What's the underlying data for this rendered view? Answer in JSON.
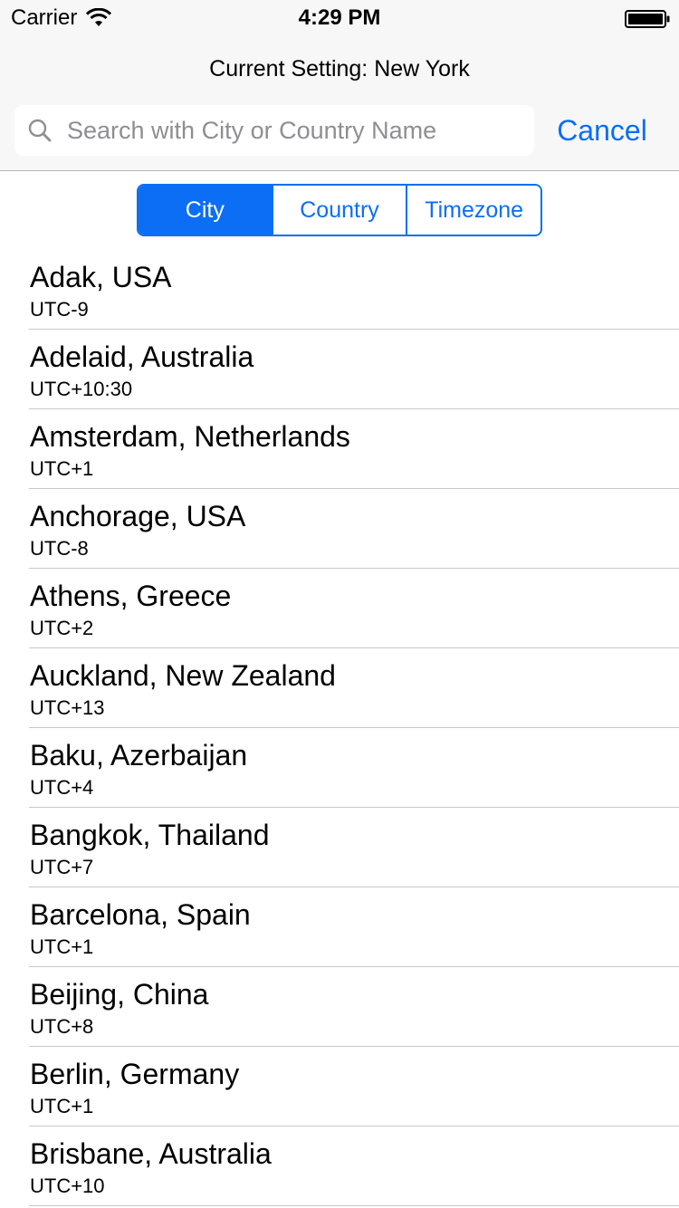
{
  "status_bar": {
    "carrier": "Carrier",
    "time": "4:29 PM"
  },
  "header": {
    "current_setting": "Current Setting: New York"
  },
  "search": {
    "placeholder": "Search with City or Country Name",
    "value": "",
    "cancel_label": "Cancel"
  },
  "segments": [
    {
      "label": "City",
      "selected": true
    },
    {
      "label": "Country",
      "selected": false
    },
    {
      "label": "Timezone",
      "selected": false
    }
  ],
  "colors": {
    "accent": "#0b6ef5",
    "separator": "#c8c7cc",
    "header_bg": "#f7f7f7"
  },
  "cities": [
    {
      "name": "Adak, USA",
      "offset": "UTC-9"
    },
    {
      "name": "Adelaid, Australia",
      "offset": "UTC+10:30"
    },
    {
      "name": "Amsterdam, Netherlands",
      "offset": "UTC+1"
    },
    {
      "name": "Anchorage, USA",
      "offset": "UTC-8"
    },
    {
      "name": "Athens, Greece",
      "offset": "UTC+2"
    },
    {
      "name": "Auckland, New Zealand",
      "offset": "UTC+13"
    },
    {
      "name": "Baku, Azerbaijan",
      "offset": "UTC+4"
    },
    {
      "name": "Bangkok, Thailand",
      "offset": "UTC+7"
    },
    {
      "name": "Barcelona, Spain",
      "offset": "UTC+1"
    },
    {
      "name": "Beijing, China",
      "offset": "UTC+8"
    },
    {
      "name": "Berlin, Germany",
      "offset": "UTC+1"
    },
    {
      "name": "Brisbane, Australia",
      "offset": "UTC+10"
    }
  ]
}
